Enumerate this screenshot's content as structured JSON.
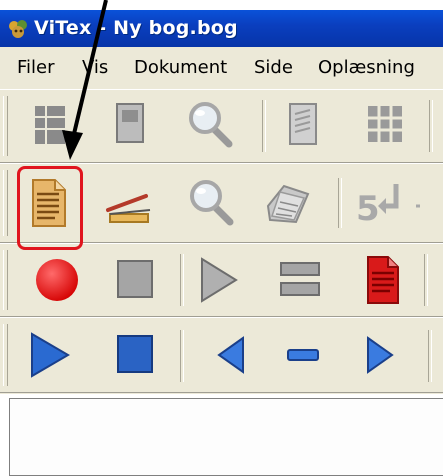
{
  "window": {
    "title": "ViTex - Ny bog.bog"
  },
  "menu": {
    "items": [
      "Filer",
      "Vis",
      "Dokument",
      "Side",
      "Oplæsning"
    ]
  },
  "toolbar1": {
    "buttons": [
      "layout-grid-icon",
      "page-icon",
      "magnifier-icon",
      "document-gray-icon",
      "table-grid-icon"
    ]
  },
  "toolbar2": {
    "buttons": [
      "document-text-icon",
      "scanner-icon",
      "magnifier-icon",
      "scanned-pages-icon",
      "page-number-return-icon"
    ],
    "page_number_glyph": "5"
  },
  "toolbar3": {
    "buttons": [
      "record-icon",
      "stop-icon",
      "play-icon",
      "pause-icon",
      "red-document-icon"
    ]
  },
  "toolbar4": {
    "buttons": [
      "play-blue-icon",
      "stop-blue-icon",
      "previous-icon",
      "pause-blue-icon",
      "next-icon"
    ]
  },
  "annotation": {
    "highlight_color": "#e0151e",
    "arrow_color": "#000000"
  }
}
